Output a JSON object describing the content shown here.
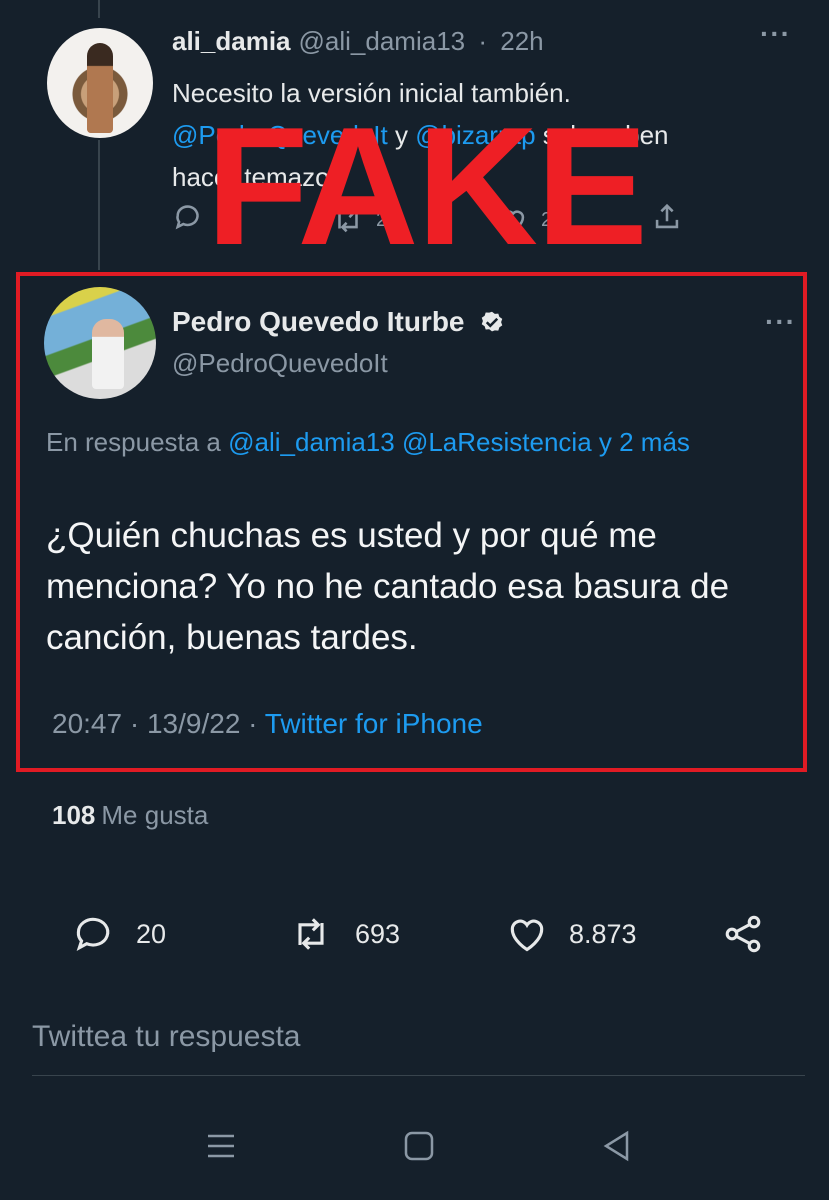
{
  "reply_tweet": {
    "name": "ali_damia",
    "handle": "@ali_damia13",
    "separator": "·",
    "time": "22h",
    "text_line1": "Necesito la versión inicial también.",
    "mention1": "@PedroQuevedoIt",
    "connector": " y ",
    "mention2": "@bizarrap",
    "text_tail": " solo saben",
    "text_line3": "hacer temazos",
    "retweets_partial": "2",
    "likes_partial": "24"
  },
  "overlay": {
    "stamp_text": "FAKE",
    "stamp_color": "#ee1f25",
    "box_color": "#e01b24"
  },
  "main_tweet": {
    "name": "Pedro Quevedo Iturbe",
    "handle": "@PedroQuevedoIt",
    "in_reply_prefix": "En respuesta a ",
    "in_reply_mentions": "@ali_damia13 @LaResistencia y 2 más",
    "text": "¿Quién chuchas es usted y por qué me menciona? Yo no he cantado esa basura de canción, buenas tardes.",
    "time": "20:47",
    "date": "13/9/22",
    "meta_separator": " · ",
    "source": "Twitter for iPhone",
    "likes_count": "108",
    "likes_label": "Me gusta"
  },
  "actions": {
    "replies": "20",
    "retweets": "693",
    "likes": "8.873",
    "icons": [
      "reply-icon",
      "retweet-icon",
      "like-icon",
      "share-icon"
    ]
  },
  "compose": {
    "placeholder": "Twittea tu respuesta"
  },
  "colors": {
    "background": "#15202b",
    "accent": "#1d9bf0",
    "muted": "#8b98a5"
  }
}
